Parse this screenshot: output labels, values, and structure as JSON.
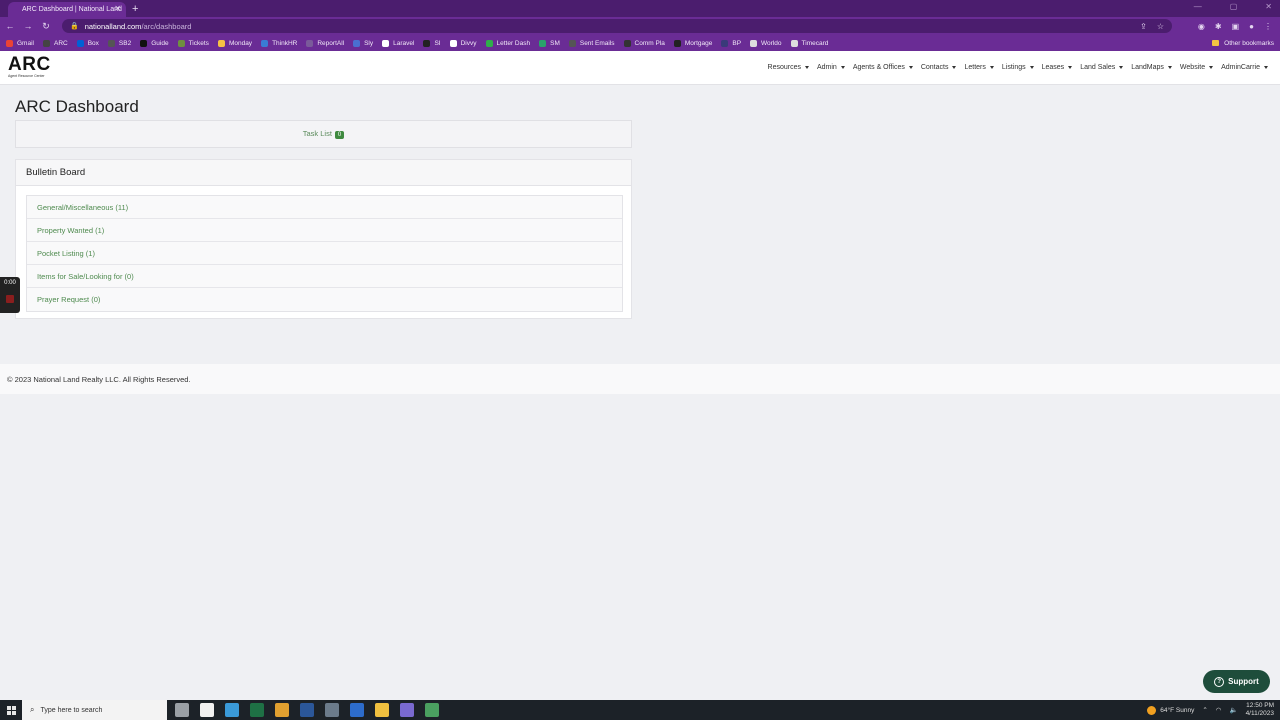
{
  "browser": {
    "tab_title": "ARC Dashboard | National Land",
    "tab_close": "✕",
    "new_tab": "+",
    "url_host": "nationalland.com",
    "url_path": "/arc/dashboard",
    "bookmarks": [
      {
        "label": "Gmail",
        "color": "#ea4335"
      },
      {
        "label": "ARC",
        "color": "#444444"
      },
      {
        "label": "Box",
        "color": "#0061d5"
      },
      {
        "label": "SB2",
        "color": "#555555"
      },
      {
        "label": "Guide",
        "color": "#111111"
      },
      {
        "label": "Tickets",
        "color": "#6f8f3f"
      },
      {
        "label": "Monday",
        "color": "#f6c244"
      },
      {
        "label": "ThinkHR",
        "color": "#3a7bd5"
      },
      {
        "label": "ReportAll",
        "color": "#7a5a9a"
      },
      {
        "label": "Sly",
        "color": "#4a6fd0"
      },
      {
        "label": "Laravel",
        "color": "#ffffff"
      },
      {
        "label": "SI",
        "color": "#222222"
      },
      {
        "label": "Divvy",
        "color": "#ffffff"
      },
      {
        "label": "Letter Dash",
        "color": "#2fae4a"
      },
      {
        "label": "SM",
        "color": "#2aa36b"
      },
      {
        "label": "Sent Emails",
        "color": "#555555"
      },
      {
        "label": "Comm Pla",
        "color": "#333333"
      },
      {
        "label": "Mortgage",
        "color": "#222222"
      },
      {
        "label": "BP",
        "color": "#3a3a7a"
      },
      {
        "label": "Worldo",
        "color": "#dddddd"
      },
      {
        "label": "Timecard",
        "color": "#dddddd"
      }
    ],
    "other_bookmarks": "Other bookmarks"
  },
  "navbar": {
    "logo_text": "ARC",
    "logo_sub": "Agent Resource Center",
    "menu": [
      "Resources",
      "Admin",
      "Agents & Offices",
      "Contacts",
      "Letters",
      "Listings",
      "Leases",
      "Land Sales",
      "LandMaps",
      "Website",
      "AdminCarrie"
    ]
  },
  "page": {
    "title": "ARC Dashboard",
    "task_list_label": "Task List",
    "task_list_count": "0",
    "bulletin_title": "Bulletin Board",
    "bulletin_items": [
      "General/Miscellaneous (11)",
      "Property Wanted (1)",
      "Pocket Listing (1)",
      "Items for Sale/Looking for (0)",
      "Prayer Request (0)"
    ]
  },
  "timer": {
    "label": "0:00"
  },
  "footer": {
    "copyright": "© 2023 National Land Realty LLC. All Rights Reserved."
  },
  "support": {
    "label": "Support",
    "icon": "?"
  },
  "taskbar": {
    "search_placeholder": "Type here to search",
    "apps": [
      {
        "name": "task-view",
        "color": "#9aa0a6"
      },
      {
        "name": "file-explorer-doc",
        "color": "#f1f1f1"
      },
      {
        "name": "browser-edge",
        "color": "#3a9ad9"
      },
      {
        "name": "excel",
        "color": "#1e7145"
      },
      {
        "name": "chrome",
        "color": "#e0a030"
      },
      {
        "name": "word",
        "color": "#2b579a"
      },
      {
        "name": "calculator",
        "color": "#6b7b8b"
      },
      {
        "name": "zoom",
        "color": "#2d6ccb"
      },
      {
        "name": "file-explorer",
        "color": "#f0c040"
      },
      {
        "name": "app-purple",
        "color": "#7a6ad0"
      },
      {
        "name": "app-green",
        "color": "#4aa060"
      }
    ],
    "weather_temp": "64°F",
    "weather_desc": "Sunny",
    "time": "12:50 PM",
    "date": "4/11/2023"
  }
}
